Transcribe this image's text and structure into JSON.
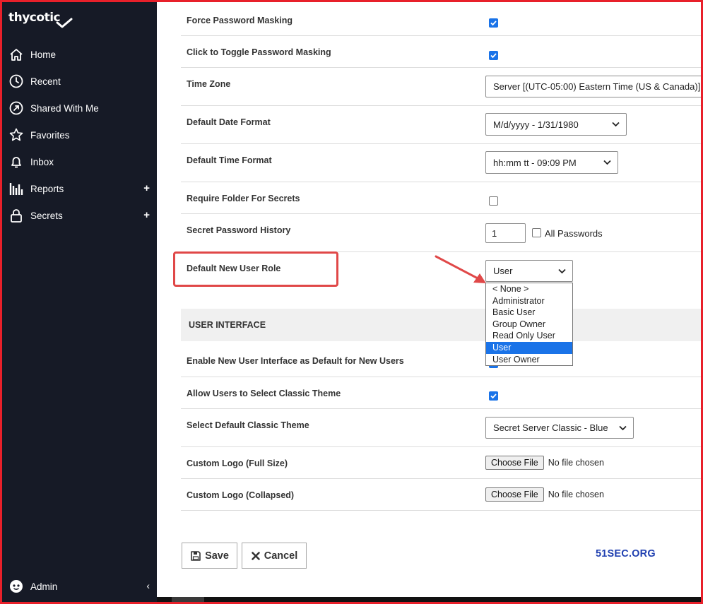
{
  "sidebar": {
    "logo": "thycotic",
    "items": [
      {
        "label": "Home",
        "icon": "home-icon",
        "expand": ""
      },
      {
        "label": "Recent",
        "icon": "clock-icon",
        "expand": ""
      },
      {
        "label": "Shared With Me",
        "icon": "share-icon",
        "expand": ""
      },
      {
        "label": "Favorites",
        "icon": "star-icon",
        "expand": ""
      },
      {
        "label": "Inbox",
        "icon": "bell-icon",
        "expand": ""
      },
      {
        "label": "Reports",
        "icon": "bar-chart-icon",
        "expand": "+"
      },
      {
        "label": "Secrets",
        "icon": "lock-icon",
        "expand": "+"
      }
    ],
    "admin": {
      "label": "Admin",
      "collapse": "‹"
    }
  },
  "settings": {
    "force_masking": {
      "label": "Force Password Masking",
      "checked": true
    },
    "toggle_masking": {
      "label": "Click to Toggle Password Masking",
      "checked": true
    },
    "time_zone": {
      "label": "Time Zone",
      "value": "Server [(UTC-05:00) Eastern Time (US & Canada)]"
    },
    "date_format": {
      "label": "Default Date Format",
      "value": "M/d/yyyy - 1/31/1980"
    },
    "time_format": {
      "label": "Default Time Format",
      "value": "hh:mm tt - 09:09 PM"
    },
    "require_folder": {
      "label": "Require Folder For Secrets",
      "checked": false
    },
    "password_history": {
      "label": "Secret Password History",
      "value": "1",
      "all_label": "All Passwords",
      "all_checked": false
    },
    "new_user_role": {
      "label": "Default New User Role",
      "value": "User",
      "options": [
        "< None >",
        "Administrator",
        "Basic User",
        "Group Owner",
        "Read Only User",
        "User",
        "User Owner"
      ],
      "selected_index": 5
    }
  },
  "ui_section": {
    "title": "USER INTERFACE",
    "enable_new_ui": {
      "label": "Enable New User Interface as Default for New Users",
      "checked": true
    },
    "allow_classic": {
      "label": "Allow Users to Select Classic Theme",
      "checked": true
    },
    "classic_theme": {
      "label": "Select Default Classic Theme",
      "value": "Secret Server Classic - Blue"
    },
    "logo_full": {
      "label": "Custom Logo (Full Size)",
      "button": "Choose File",
      "status": "No file chosen"
    },
    "logo_collapsed": {
      "label": "Custom Logo (Collapsed)",
      "button": "Choose File",
      "status": "No file chosen"
    }
  },
  "actions": {
    "save": "Save",
    "cancel": "Cancel"
  },
  "watermark": "51SEC.ORG",
  "colors": {
    "sidebar_bg": "#161a26",
    "accent": "#1a73e8",
    "annotation": "#e04848",
    "frame": "#e8202a",
    "watermark": "#1f3fb0"
  }
}
